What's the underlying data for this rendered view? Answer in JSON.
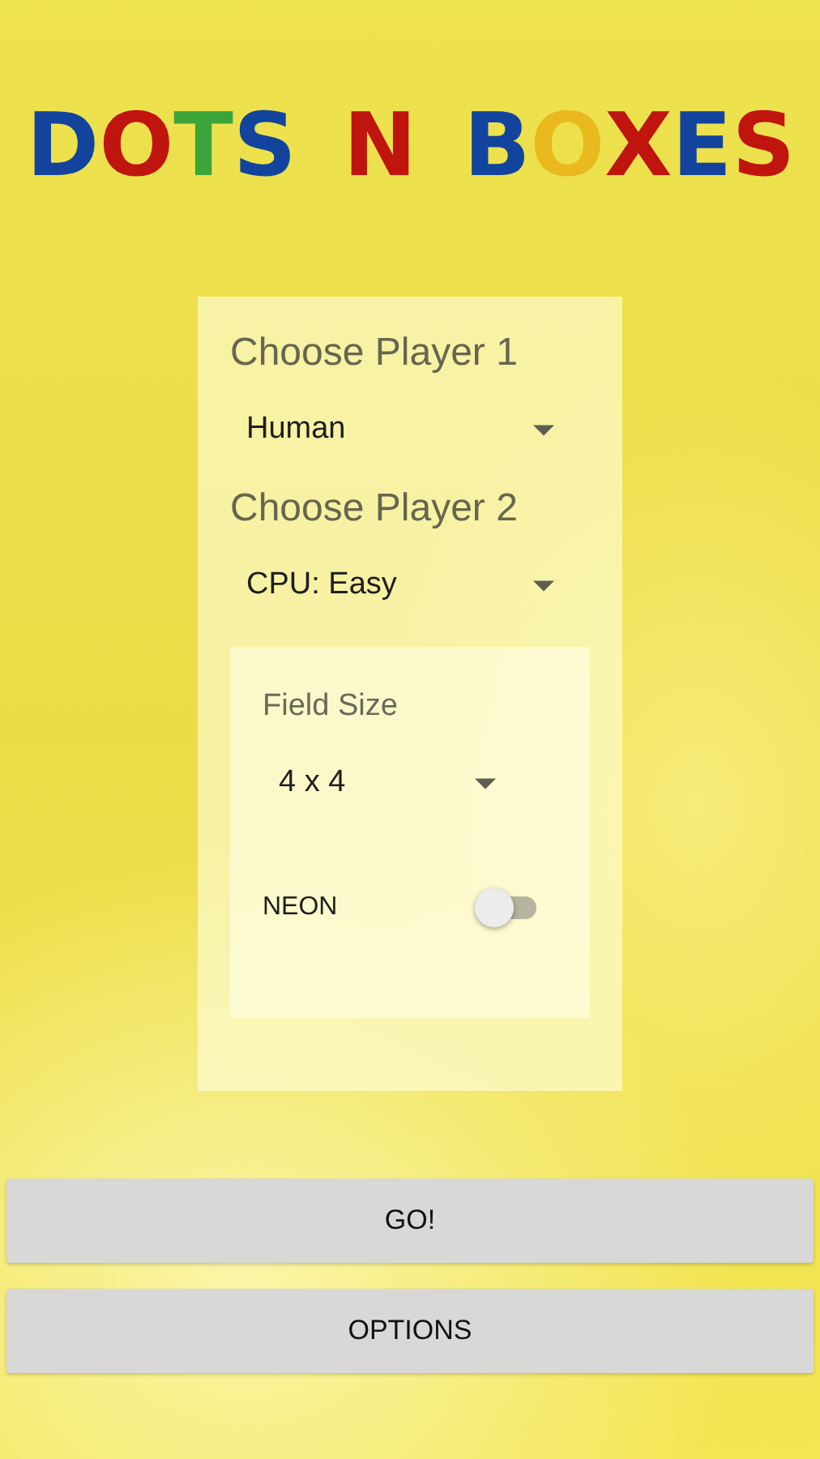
{
  "logo": {
    "words": [
      {
        "letters": [
          {
            "char": "D",
            "color": "#12449e"
          },
          {
            "char": "O",
            "color": "#c0140f"
          },
          {
            "char": "T",
            "color": "#3ca53a"
          },
          {
            "char": "S",
            "color": "#12449e"
          }
        ]
      },
      {
        "letters": [
          {
            "char": "N",
            "color": "#c0140f"
          }
        ]
      },
      {
        "letters": [
          {
            "char": "B",
            "color": "#12449e"
          },
          {
            "char": "O",
            "color": "#e9b91e"
          },
          {
            "char": "X",
            "color": "#c0140f"
          },
          {
            "char": "E",
            "color": "#12449e"
          },
          {
            "char": "S",
            "color": "#c0140f"
          }
        ]
      }
    ]
  },
  "settings": {
    "player1": {
      "label": "Choose Player 1",
      "value": "Human"
    },
    "player2": {
      "label": "Choose Player 2",
      "value": "CPU: Easy"
    },
    "field": {
      "label": "Field Size",
      "value": "4 x 4"
    },
    "neon": {
      "label": "NEON",
      "on": false
    }
  },
  "buttons": [
    "GO!",
    "OPTIONS"
  ]
}
